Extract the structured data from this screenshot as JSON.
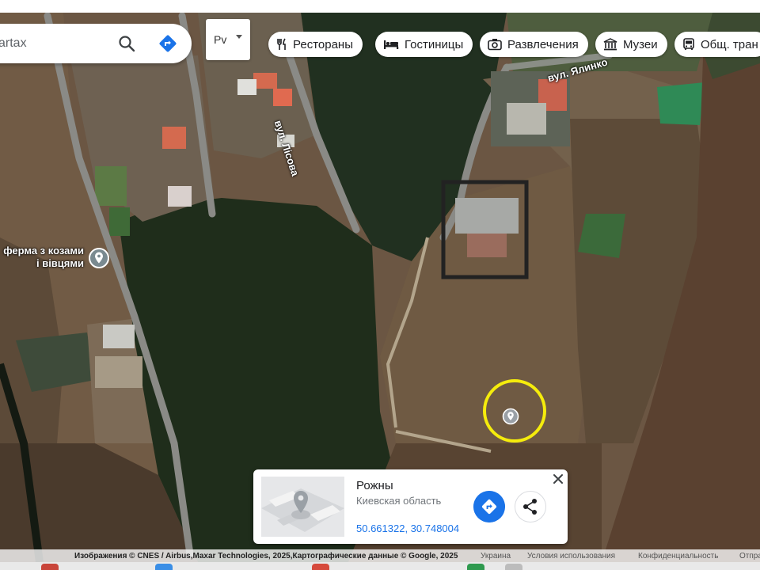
{
  "search": {
    "placeholder": "artax"
  },
  "layer_button": {
    "label": "Pv"
  },
  "chips": [
    {
      "label": "Рестораны",
      "icon": "fork-knife-icon"
    },
    {
      "label": "Гостиницы",
      "icon": "bed-icon"
    },
    {
      "label": "Развлечения",
      "icon": "camera-icon"
    },
    {
      "label": "Музеи",
      "icon": "museum-icon"
    },
    {
      "label": "Общ. тран",
      "icon": "bus-icon"
    }
  ],
  "map_labels": {
    "street_lisova": "вул. Лісова",
    "street_yalinkova": "вул. Ялинко",
    "poi_label_line1": "ферма з козами",
    "poi_label_line2": "і вівцями"
  },
  "place_card": {
    "name": "Рожны",
    "region": "Киевская область",
    "coordinates": "50.661322, 30.748004"
  },
  "attribution": {
    "source": "Изображения © CNES / Airbus,Maxar Technologies, 2025,Картографические данные © Google, 2025",
    "country": "Украина",
    "terms": "Условия использования",
    "privacy": "Конфиденциальность",
    "feedback": "Отпра"
  },
  "colors": {
    "accent_blue": "#1a73e8",
    "highlight_ring": "#f5ec0c",
    "forest": "#1f2d1b",
    "field_brown": "#6b5643",
    "plowed_field": "#5a4130"
  }
}
